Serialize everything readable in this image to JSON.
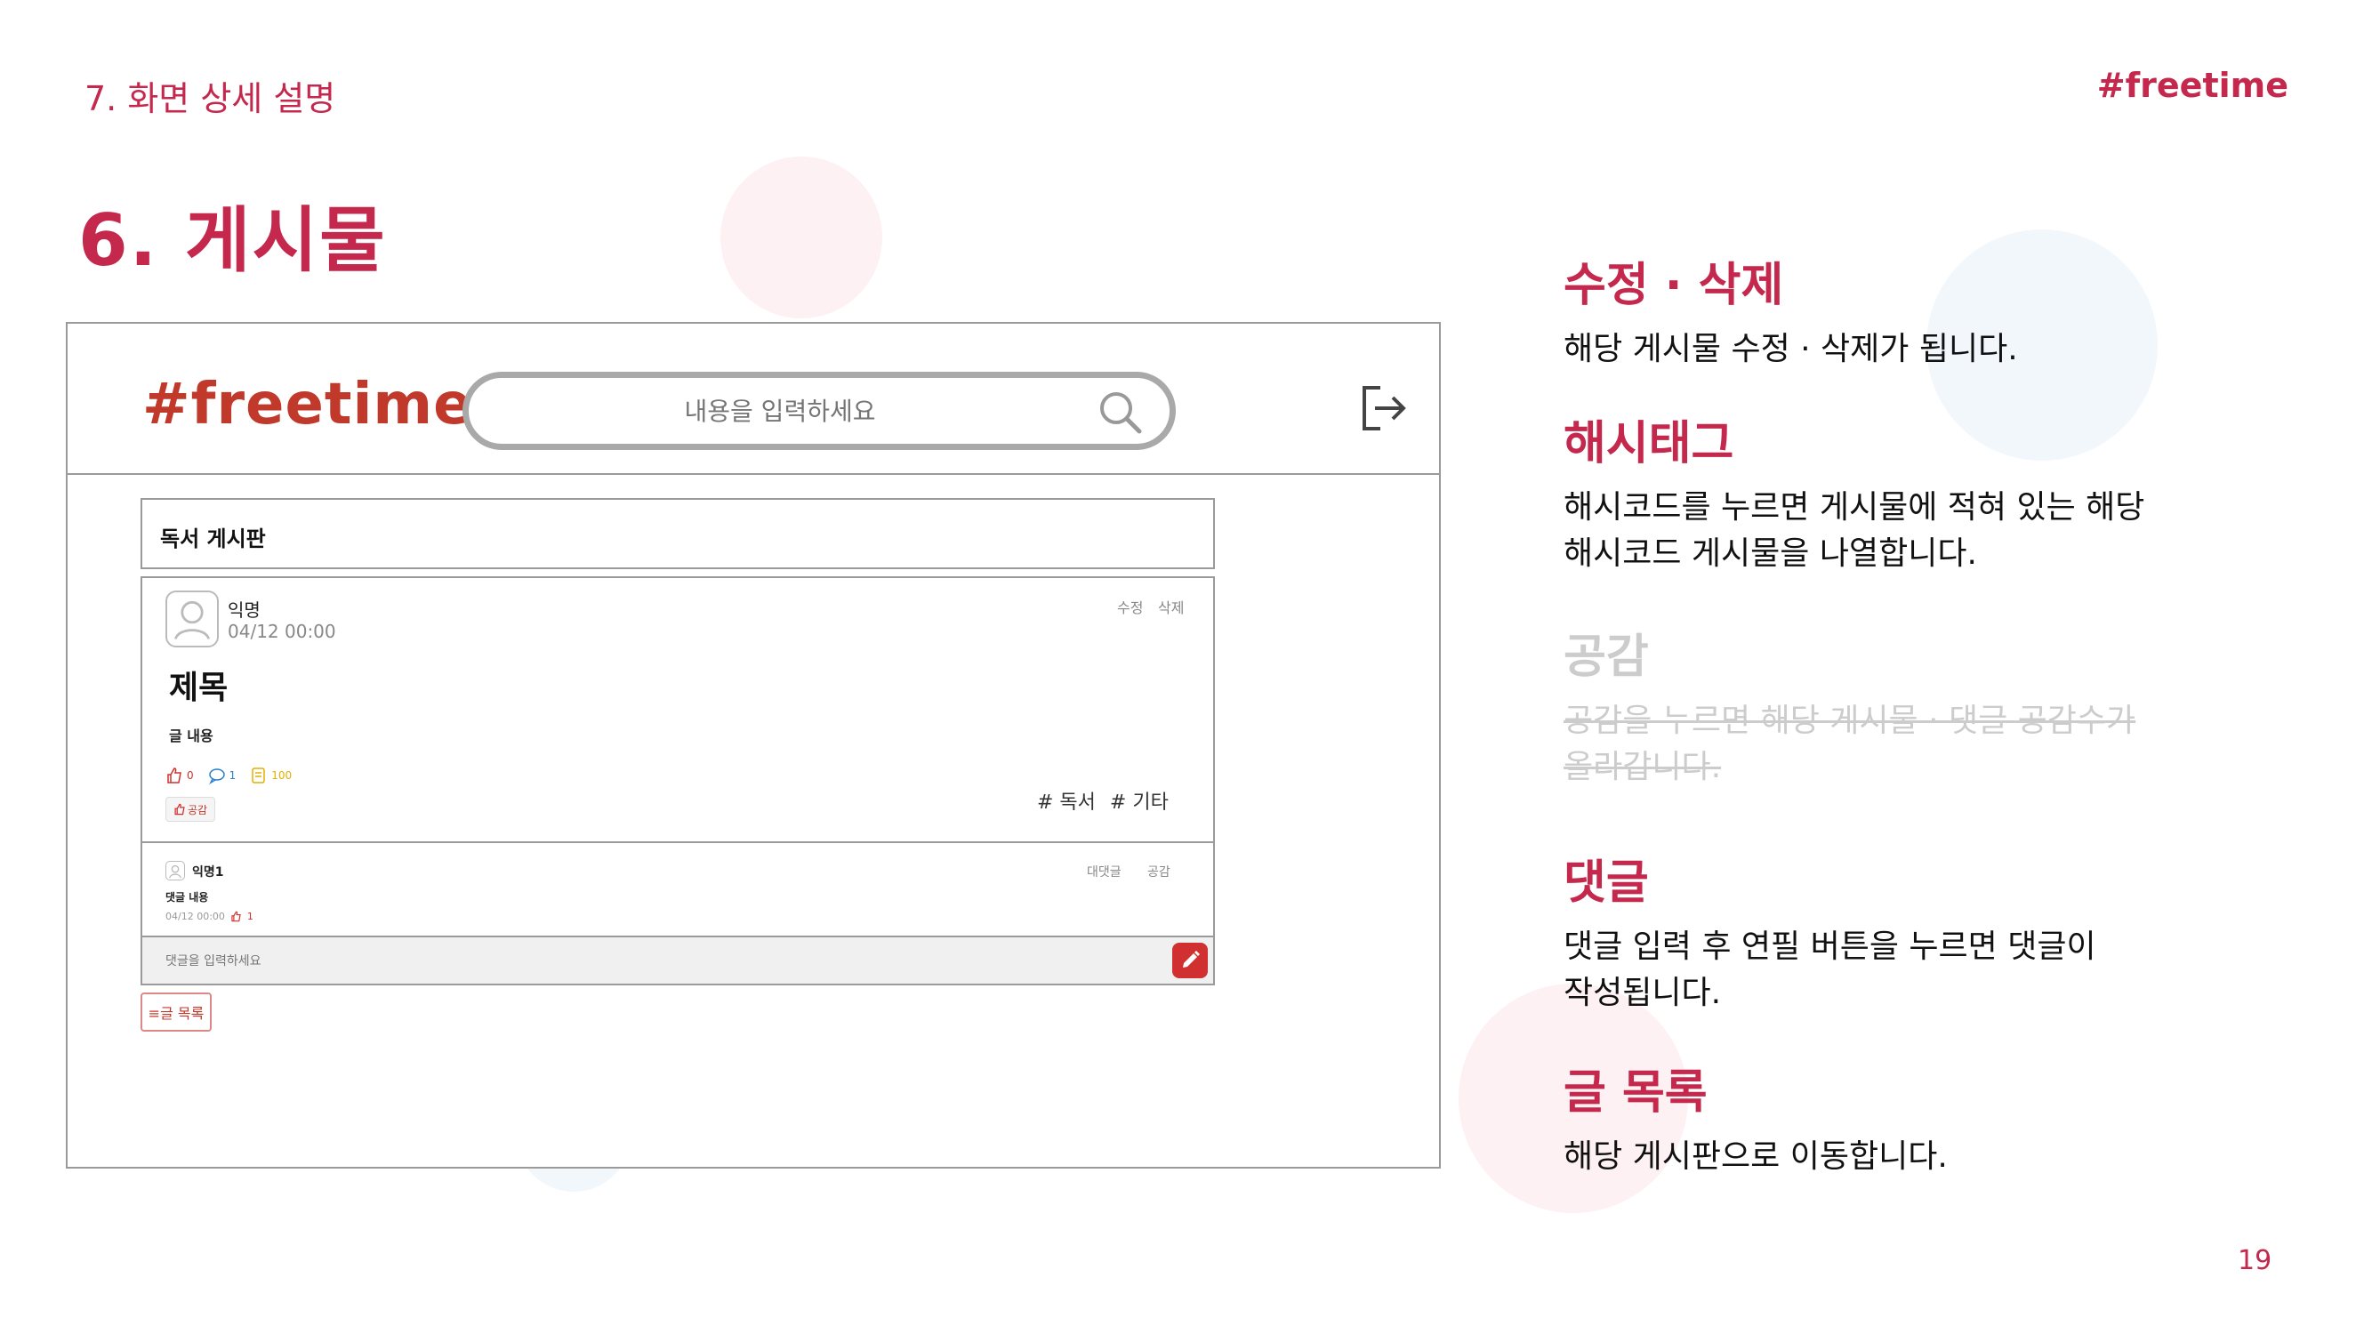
{
  "slide": {
    "section_label": "7. 화면 상세 설명",
    "brand": "#freetime",
    "title": "6. 게시물",
    "page_number": "19"
  },
  "mockup": {
    "brand": "#freetime",
    "search_placeholder": "내용을 입력하세요",
    "board_name": "독서 게시판",
    "post": {
      "author": "익명",
      "time": "04/12 00:00",
      "edit_label": "수정",
      "delete_label": "삭제",
      "title": "제목",
      "body": "글 내용",
      "like_count": "0",
      "comment_count": "1",
      "view_count": "100",
      "like_button_label": "공감",
      "tags": [
        "# 독서",
        "# 기타"
      ]
    },
    "comment": {
      "author": "익명1",
      "body": "댓글 내용",
      "time": "04/12 00:00",
      "like_count": "1",
      "reply_label": "대댓글",
      "like_label": "공감"
    },
    "comment_input_placeholder": "댓글을 입력하세요",
    "list_button_label": "≡글 목록"
  },
  "descriptions": [
    {
      "title": "수정 · 삭제",
      "lines": [
        "해당 게시물 수정 · 삭제가 됩니다."
      ]
    },
    {
      "title": "해시태그",
      "lines": [
        "해시코드를 누르면 게시물에 적혀 있는 해당",
        "해시코드 게시물을 나열합니다."
      ]
    },
    {
      "title": "공감",
      "lines": [
        "공감을 누르면 해당 게시물 · 댓글 공감수가",
        "올라갑니다."
      ]
    },
    {
      "title": "댓글",
      "lines": [
        "댓글 입력 후 연필 버튼을 누르면 댓글이",
        "작성됩니다."
      ]
    },
    {
      "title": "글 목록",
      "lines": [
        "해당 게시판으로 이동합니다."
      ]
    }
  ],
  "colors": {
    "accent": "#c4294d",
    "mock_brand": "#c0392b",
    "disabled": "#cccccc"
  }
}
